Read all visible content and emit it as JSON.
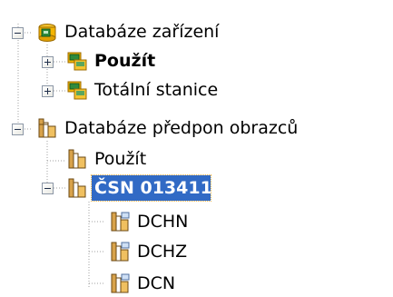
{
  "tree": {
    "nodes": [
      {
        "label": "Databáze zařízení",
        "icon": "database-device-icon",
        "expander": "minus",
        "bold": false,
        "selected": false
      },
      {
        "label": "Použít",
        "icon": "device-icon",
        "expander": "plus",
        "bold": true,
        "selected": false
      },
      {
        "label": "Totální stanice",
        "icon": "device-icon",
        "expander": "plus",
        "bold": false,
        "selected": false
      },
      {
        "label": "Databáze předpon obrazců",
        "icon": "database-prefix-icon",
        "expander": "minus",
        "bold": false,
        "selected": false
      },
      {
        "label": "Použít",
        "icon": "prefix-icon",
        "expander": "none",
        "bold": false,
        "selected": false
      },
      {
        "label": "ČSN 013411",
        "icon": "prefix-icon",
        "expander": "minus",
        "bold": true,
        "selected": true
      },
      {
        "label": "DCHN",
        "icon": "prefix-item-icon",
        "expander": "none",
        "bold": false,
        "selected": false
      },
      {
        "label": "DCHZ",
        "icon": "prefix-item-icon",
        "expander": "none",
        "bold": false,
        "selected": false
      },
      {
        "label": "DCN",
        "icon": "prefix-item-icon",
        "expander": "none",
        "bold": false,
        "selected": false
      }
    ]
  },
  "colors": {
    "selection": "#316ac5",
    "device_icon_yellow": "#f4b400",
    "device_icon_green": "#2e8b3c",
    "prefix_icon_gold": "#d8a24a"
  }
}
